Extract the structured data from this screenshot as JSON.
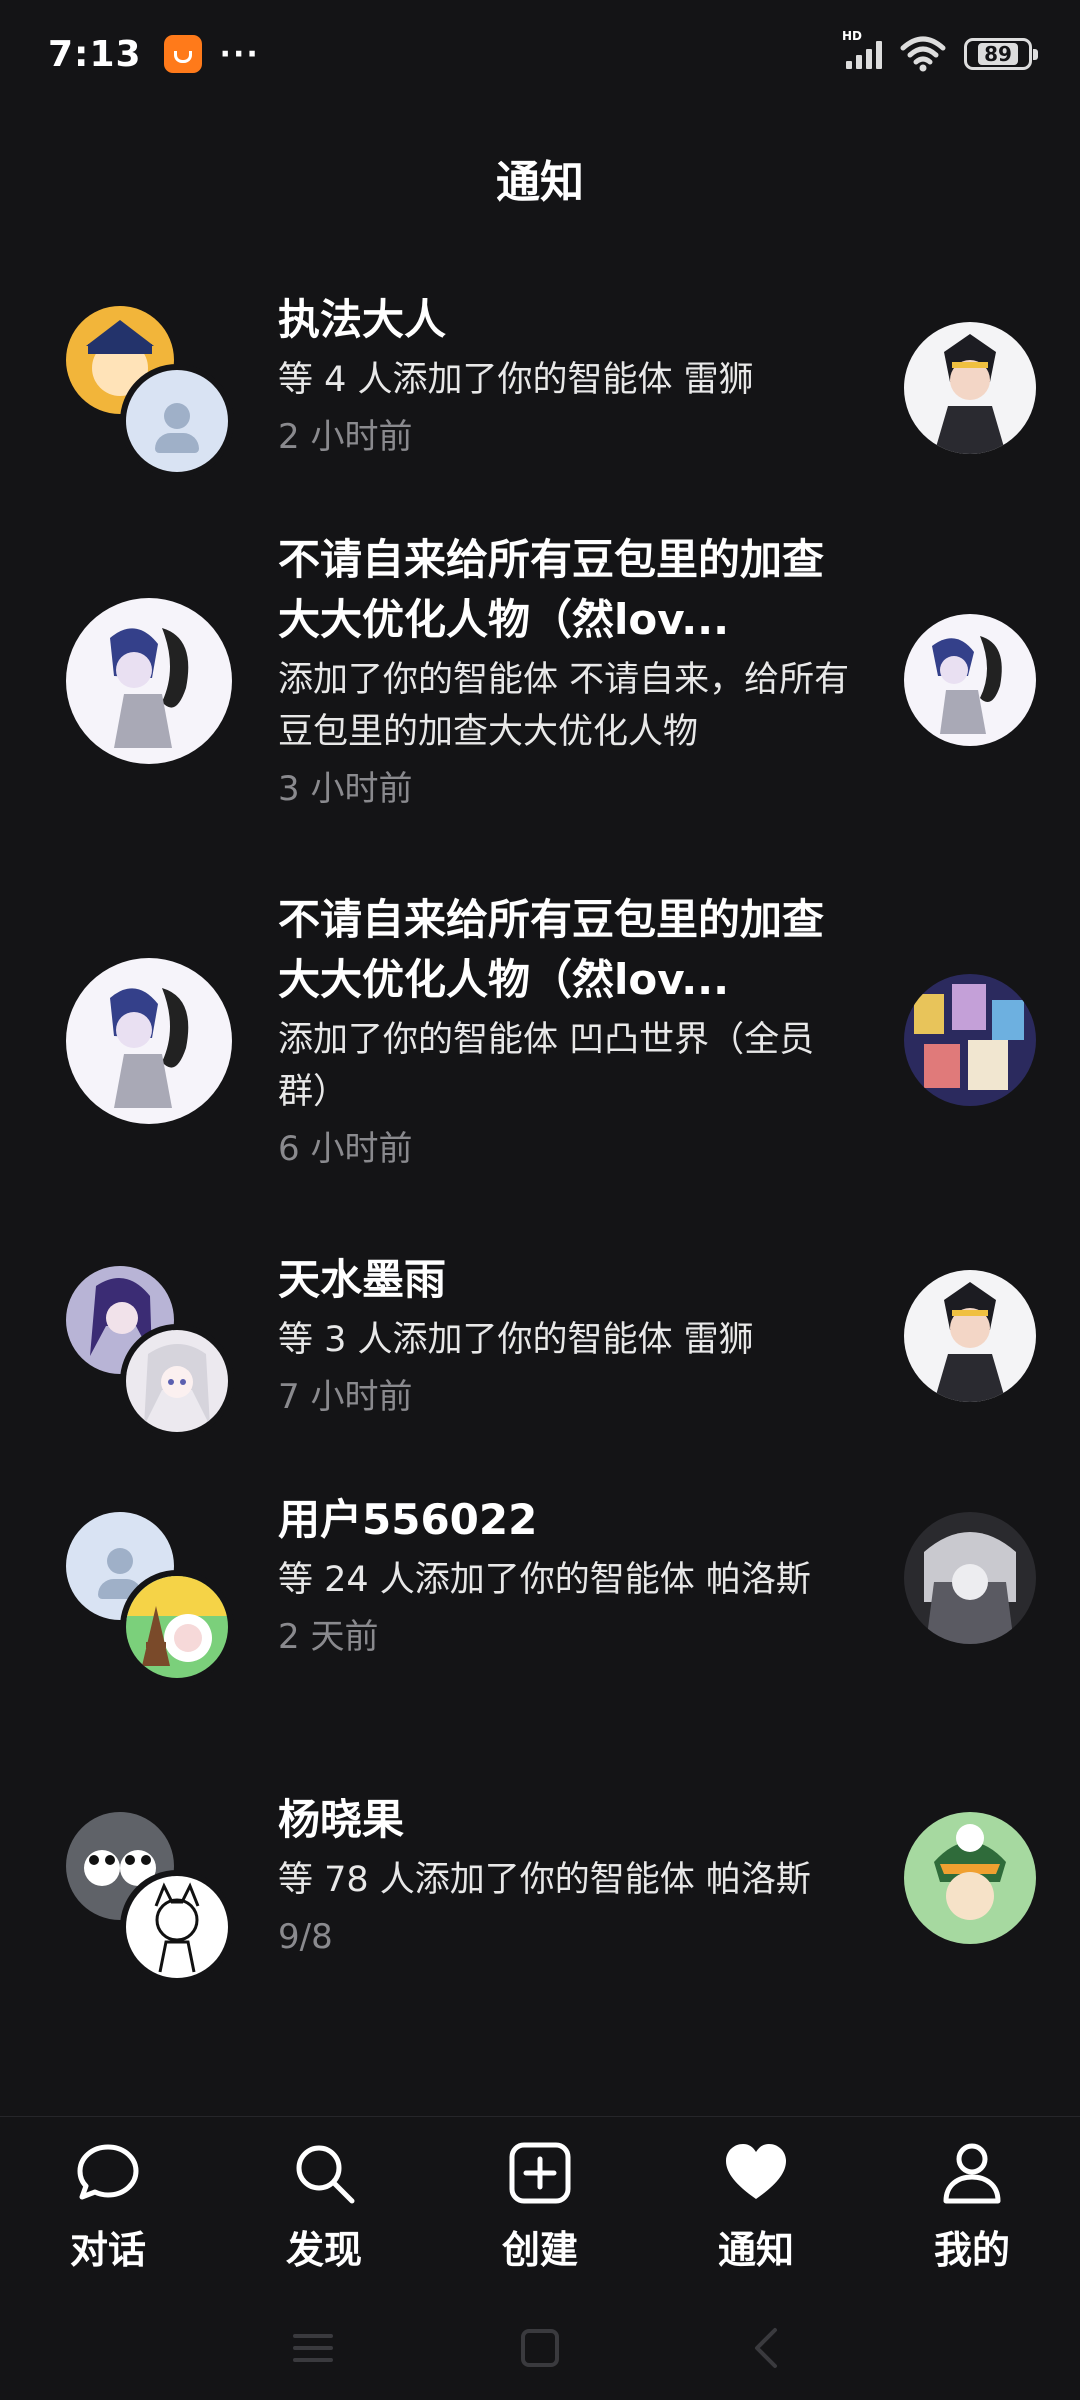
{
  "status_bar": {
    "time": "7:13",
    "more": "···",
    "network": "HD",
    "battery": "89"
  },
  "page": {
    "title": "通知"
  },
  "notifications": [
    {
      "name": "执法大人",
      "desc": "等 4 人添加了你的智能体 雷狮",
      "time": "2 小时前"
    },
    {
      "name": "不请自来给所有豆包里的加查大大优化人物（然lov...",
      "desc": "添加了你的智能体 不请自来，给所有豆包里的加查大大优化人物",
      "time": "3 小时前"
    },
    {
      "name": "不请自来给所有豆包里的加查大大优化人物（然lov...",
      "desc": "添加了你的智能体 凹凸世界（全员群）",
      "time": "6 小时前"
    },
    {
      "name": "天水墨雨",
      "desc": "等 3 人添加了你的智能体 雷狮",
      "time": "7 小时前"
    },
    {
      "name": "用户556022",
      "desc": "等 24 人添加了你的智能体 帕洛斯",
      "time": "2 天前"
    },
    {
      "name": "杨晓果",
      "desc": "等 78 人添加了你的智能体 帕洛斯",
      "time": "9/8"
    }
  ],
  "tabs": [
    {
      "label": "对话",
      "icon": "chat-bubble-icon"
    },
    {
      "label": "发现",
      "icon": "search-icon"
    },
    {
      "label": "创建",
      "icon": "plus-square-icon"
    },
    {
      "label": "通知",
      "icon": "heart-icon"
    },
    {
      "label": "我的",
      "icon": "person-icon"
    }
  ],
  "colors": {
    "background": "#141416",
    "secondary_text": "#8a8a8e"
  }
}
